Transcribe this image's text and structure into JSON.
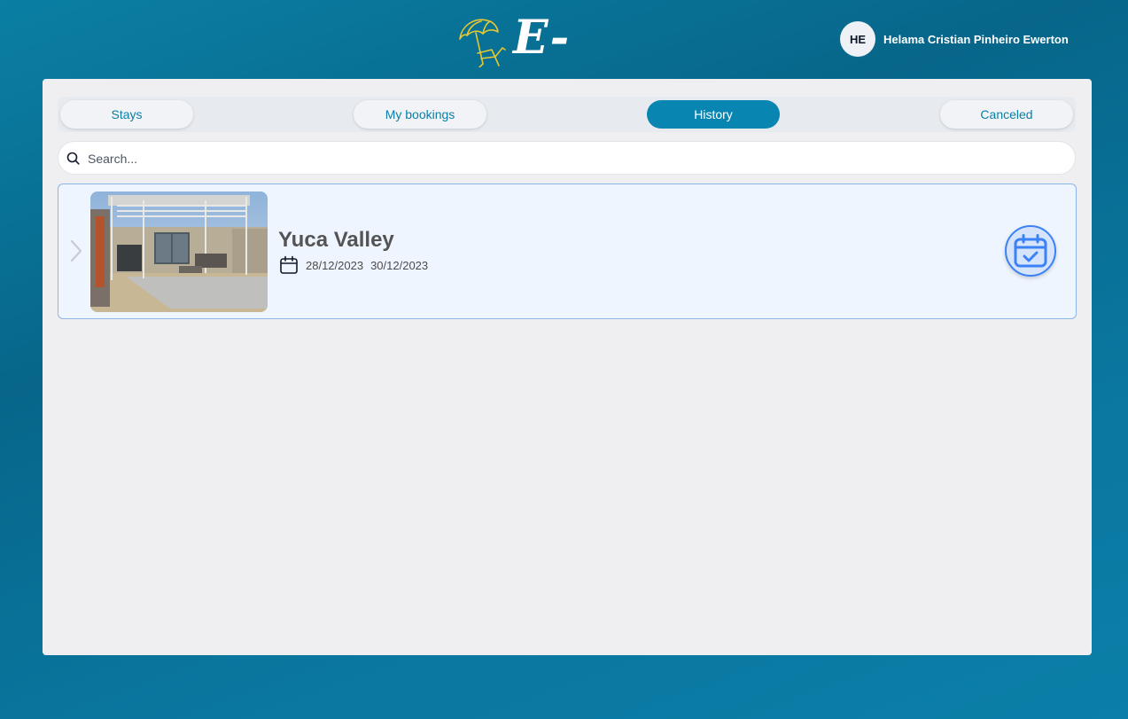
{
  "app": {
    "logo_text": "E-booking",
    "logo_icon": "beach-umbrella-chair-icon",
    "accent_color": "#0985b2"
  },
  "user": {
    "initials": "HE",
    "name": "Helama Cristian Pinheiro Ewerton"
  },
  "tabs": [
    {
      "label": "Stays",
      "active": false
    },
    {
      "label": "My bookings",
      "active": false
    },
    {
      "label": "History",
      "active": true
    },
    {
      "label": "Canceled",
      "active": false
    }
  ],
  "search": {
    "placeholder": "Search...",
    "value": "",
    "icon": "search-icon"
  },
  "bookings": [
    {
      "title": "Yuca Valley",
      "check_in": "28/12/2023",
      "check_out": "30/12/2023",
      "date_icon": "calendar-icon",
      "status_icon": "calendar-check-icon",
      "expand_icon": "chevron-right-icon"
    }
  ]
}
